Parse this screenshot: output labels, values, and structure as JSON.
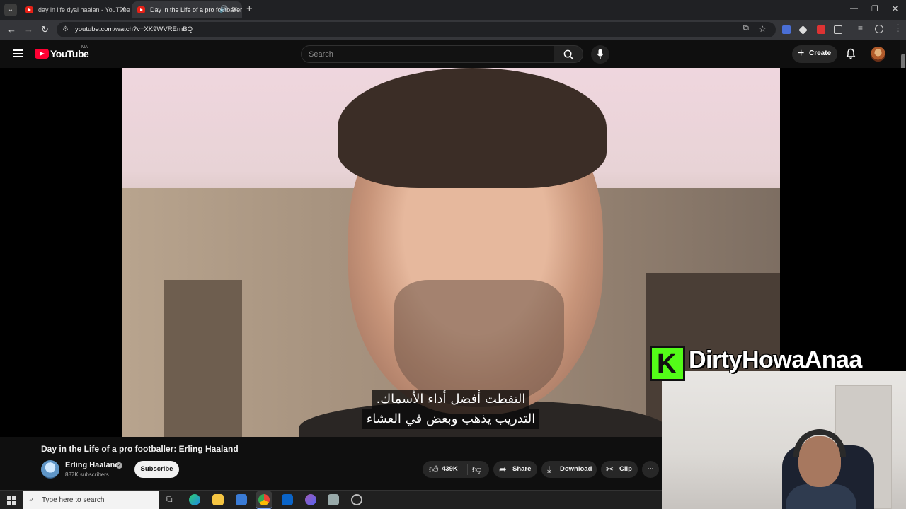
{
  "browser": {
    "tabs": [
      {
        "title": "day in life dyal haalan - YouTube",
        "active": false
      },
      {
        "title": "Day in the Life of a pro footballer: Erling Haaland",
        "active": true
      }
    ],
    "url": "youtube.com/watch?v=XK9WVRErnBQ"
  },
  "youtube": {
    "logo_text": "YouTube",
    "country_code": "MA",
    "search_placeholder": "Search",
    "create_label": "Create"
  },
  "video": {
    "subtitle_line1": "التقطت أفضل أداء الأسماك.",
    "subtitle_line2": "التدريب يذهب وبعض في العشاء",
    "title": "Day in the Life of a pro footballer: Erling Haaland",
    "channel_name": "Erling Haaland",
    "subscriber_count": "887K subscribers",
    "subscribe_label": "Subscribe",
    "like_count": "439K",
    "share_label": "Share",
    "download_label": "Download",
    "clip_label": "Clip"
  },
  "overlay": {
    "badge_letter": "K",
    "streamer_name": "DirtyHowaAnaa"
  },
  "taskbar": {
    "search_placeholder": "Type here to search"
  },
  "colors": {
    "youtube_red": "#ff0033",
    "kick_green": "#53fc18",
    "background": "#0f0f0f"
  }
}
